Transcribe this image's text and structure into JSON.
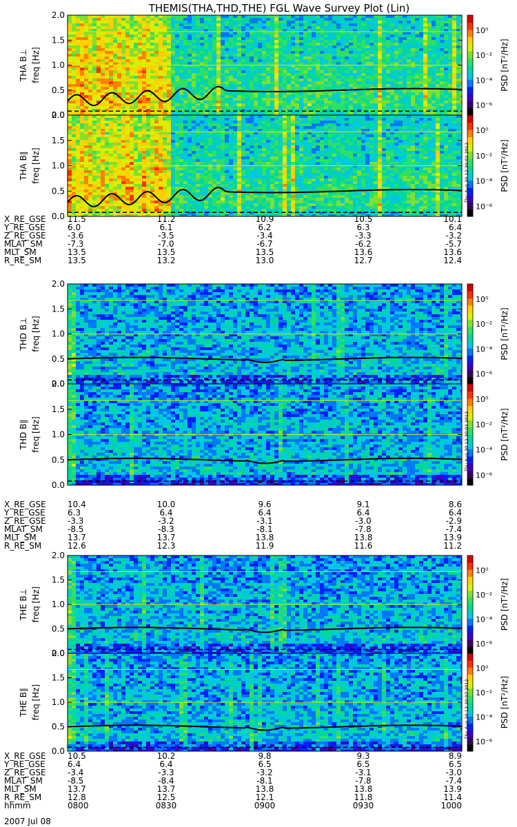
{
  "title": "THEMIS(THA,THD,THE) FGL Wave Survey Plot (Lin)",
  "date": "2007 Jul 08",
  "colors": {
    "colormap": [
      "#000000",
      "#3a0068",
      "#3a00c8",
      "#0020ff",
      "#0078ff",
      "#00c8e0",
      "#00d8a0",
      "#30e060",
      "#80e030",
      "#d8f000",
      "#ffd000",
      "#ff8000",
      "#ff3000",
      "#d80000"
    ],
    "line": "#000000"
  },
  "chart_data": [
    {
      "type": "heatmap",
      "probe": "THA",
      "ylabel": "THA B⊥",
      "yunit": "freq [Hz]",
      "ylim": [
        0,
        2.0
      ],
      "yticks": [
        "0.0",
        "0.5",
        "1.0",
        "1.5",
        "2.0"
      ],
      "colorbar": {
        "label": "PSD [nT²/Hz]",
        "ticks": [
          "10⁰",
          "10⁻²",
          "10⁻⁴",
          "10⁻⁶"
        ]
      },
      "stamp": "",
      "activity": "high",
      "solid_line_hz": 0.5,
      "dashed_line_hz": 0.08
    },
    {
      "type": "heatmap",
      "probe": "THA",
      "ylabel": "THA B∥",
      "yunit": "freq [Hz]",
      "ylim": [
        0,
        2.0
      ],
      "yticks": [
        "0.0",
        "0.5",
        "1.0",
        "1.5",
        "2.0"
      ],
      "colorbar": {
        "label": "PSD [nT²/Hz]",
        "ticks": [
          "10⁰",
          "10⁻²",
          "10⁻⁴",
          "10⁻⁶"
        ]
      },
      "stamp": "Thu Aug 30 12:30:02 2012",
      "activity": "high",
      "solid_line_hz": 0.5,
      "dashed_line_hz": 0.08
    },
    {
      "type": "heatmap",
      "probe": "THD",
      "ylabel": "THD B⊥",
      "yunit": "freq [Hz]",
      "ylim": [
        0,
        2.0
      ],
      "yticks": [
        "0.0",
        "0.5",
        "1.0",
        "1.5",
        "2.0"
      ],
      "colorbar": {
        "label": "PSD [nT²/Hz]",
        "ticks": [
          "10⁰",
          "10⁻²",
          "10⁻⁴",
          "10⁻⁶"
        ]
      },
      "stamp": "",
      "activity": "low",
      "solid_line_hz": 0.5,
      "dashed_line_hz": 0.08
    },
    {
      "type": "heatmap",
      "probe": "THD",
      "ylabel": "THD B∥",
      "yunit": "freq [Hz]",
      "ylim": [
        0,
        2.0
      ],
      "yticks": [
        "0.0",
        "0.5",
        "1.0",
        "1.5",
        "2.0"
      ],
      "colorbar": {
        "label": "PSD [nT²/Hz]",
        "ticks": [
          "10⁰",
          "10⁻²",
          "10⁻⁴",
          "10⁻⁶"
        ]
      },
      "stamp": "Thu Aug 30 12:30:03 2012",
      "activity": "low",
      "solid_line_hz": 0.5,
      "dashed_line_hz": 0.08
    },
    {
      "type": "heatmap",
      "probe": "THE",
      "ylabel": "THE B⊥",
      "yunit": "freq [Hz]",
      "ylim": [
        0,
        2.0
      ],
      "yticks": [
        "0.0",
        "0.5",
        "1.0",
        "1.5",
        "2.0"
      ],
      "colorbar": {
        "label": "PSD [nT²/Hz]",
        "ticks": [
          "10⁰",
          "10⁻²",
          "10⁻⁴",
          "10⁻⁶"
        ]
      },
      "stamp": "",
      "activity": "low",
      "solid_line_hz": 0.5,
      "dashed_line_hz": 0.08
    },
    {
      "type": "heatmap",
      "probe": "THE",
      "ylabel": "THE B∥",
      "yunit": "freq [Hz]",
      "ylim": [
        0,
        2.0
      ],
      "yticks": [
        "0.0",
        "0.5",
        "1.0",
        "1.5",
        "2.0"
      ],
      "colorbar": {
        "label": "PSD [nT²/Hz]",
        "ticks": [
          "10⁰",
          "10⁻²",
          "10⁻⁴",
          "10⁻⁶"
        ]
      },
      "stamp": "Thu Aug 30 12:30:03 2012",
      "activity": "low",
      "solid_line_hz": 0.5,
      "dashed_line_hz": 0.08
    }
  ],
  "ephemeris": [
    {
      "probe": "THA",
      "rows": [
        {
          "label": "X_RE_GSE",
          "values": [
            "11.5",
            "11.2",
            "10.9",
            "10.5",
            "10.1"
          ]
        },
        {
          "label": "Y_RE_GSE",
          "values": [
            "6.0",
            "6.1",
            "6.2",
            "6.3",
            "6.4"
          ]
        },
        {
          "label": "Z_RE_GSE",
          "values": [
            "-3.6",
            "-3.5",
            "-3.4",
            "-3.3",
            "-3.2"
          ]
        },
        {
          "label": "MLAT_SM",
          "values": [
            "-7.3",
            "-7.0",
            "-6.7",
            "-6.2",
            "-5.7"
          ]
        },
        {
          "label": "MLT_SM",
          "values": [
            "13.5",
            "13.5",
            "13.5",
            "13.6",
            "13.6"
          ]
        },
        {
          "label": "R_RE_SM",
          "values": [
            "13.5",
            "13.2",
            "13.0",
            "12.7",
            "12.4"
          ]
        }
      ]
    },
    {
      "probe": "THD",
      "rows": [
        {
          "label": "X_RE_GSE",
          "values": [
            "10.4",
            "10.0",
            "9.6",
            "9.1",
            "8.6"
          ]
        },
        {
          "label": "Y_RE_GSE",
          "values": [
            "6.3",
            "6.4",
            "6.4",
            "6.4",
            "6.4"
          ]
        },
        {
          "label": "Z_RE_GSE",
          "values": [
            "-3.3",
            "-3.2",
            "-3.1",
            "-3.0",
            "-2.9"
          ]
        },
        {
          "label": "MLAT_SM",
          "values": [
            "-8.5",
            "-8.3",
            "-8.1",
            "-7.8",
            "-7.4"
          ]
        },
        {
          "label": "MLT_SM",
          "values": [
            "13.7",
            "13.7",
            "13.8",
            "13.8",
            "13.9"
          ]
        },
        {
          "label": "R_RE_SM",
          "values": [
            "12.6",
            "12.3",
            "11.9",
            "11.6",
            "11.2"
          ]
        }
      ]
    },
    {
      "probe": "THE",
      "rows": [
        {
          "label": "X_RE_GSE",
          "values": [
            "10.5",
            "10.2",
            "9.8",
            "9.3",
            "8.9"
          ]
        },
        {
          "label": "Y_RE_GSE",
          "values": [
            "6.4",
            "6.4",
            "6.5",
            "6.5",
            "6.5"
          ]
        },
        {
          "label": "Z_RE_GSE",
          "values": [
            "-3.4",
            "-3.3",
            "-3.2",
            "-3.1",
            "-3.0"
          ]
        },
        {
          "label": "MLAT_SM",
          "values": [
            "-8.5",
            "-8.4",
            "-8.1",
            "-7.8",
            "-7.4"
          ]
        },
        {
          "label": "MLT_SM",
          "values": [
            "13.7",
            "13.7",
            "13.8",
            "13.8",
            "13.9"
          ]
        },
        {
          "label": "R_RE_SM",
          "values": [
            "12.8",
            "12.5",
            "12.1",
            "11.8",
            "11.4"
          ]
        },
        {
          "label": "hhmm",
          "values": [
            "0800",
            "0830",
            "0900",
            "0930",
            "1000"
          ]
        }
      ]
    }
  ]
}
